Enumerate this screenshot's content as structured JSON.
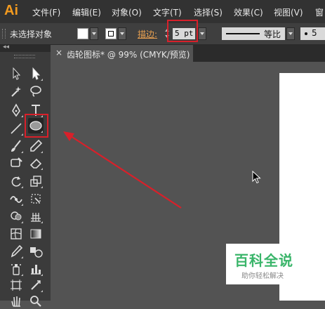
{
  "app": {
    "logo": "Ai",
    "accent_color": "#f29a1f"
  },
  "menubar": {
    "items": [
      "文件(F)",
      "编辑(E)",
      "对象(O)",
      "文字(T)",
      "选择(S)",
      "效果(C)",
      "视图(V)",
      "窗"
    ]
  },
  "control_bar": {
    "selection_status": "未选择对象",
    "fill_color": "#ffffff",
    "stroke_label": "描边:",
    "stroke_value": "5 pt",
    "profile_label": "等比",
    "brush_size": "5"
  },
  "document_tab": {
    "close_glyph": "×",
    "title": "齿轮图标* @ 99% (CMYK/预览)"
  },
  "toolbox": {
    "active_tool": "ellipse-tool",
    "highlight_color": "#d8202a"
  },
  "annotation": {
    "arrow_color": "#d8202a"
  },
  "watermark": {
    "title": "百科全说",
    "subtitle": "助你轻松解决"
  }
}
